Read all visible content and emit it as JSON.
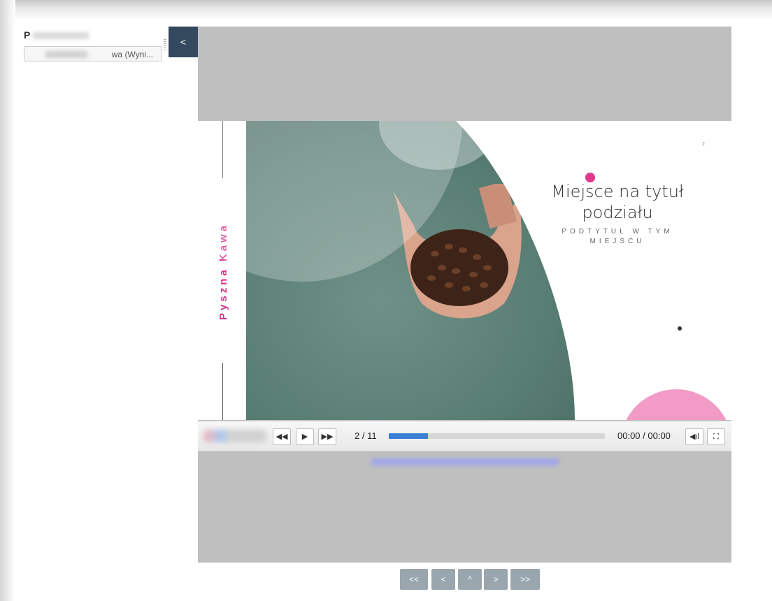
{
  "sidebar": {
    "title": "P",
    "select_value": "wa (Wyni..."
  },
  "collapse_label": "<",
  "slide": {
    "brand_vertical": "Pyszna Kawa",
    "title": "Miejsce na tytuł podziału",
    "subtitle": "PODTYTUŁ W TYM MIEJSCU",
    "page_marker": "2"
  },
  "player": {
    "rewind_icon": "rewind-icon",
    "play_icon": "play-icon",
    "forward_icon": "fast-forward-icon",
    "counter": "2 / 11",
    "progress": 0.18,
    "time": "00:00 / 00:00",
    "volume_icon": "volume-icon",
    "fullscreen_icon": "fullscreen-icon"
  },
  "nav": {
    "first": "<<",
    "prev": "<",
    "up": "^",
    "next": ">",
    "last": ">>"
  },
  "colors": {
    "accent_pink": "#d6338a",
    "progress_blue": "#3a7fd5",
    "sidebar_button": "#34495e"
  }
}
